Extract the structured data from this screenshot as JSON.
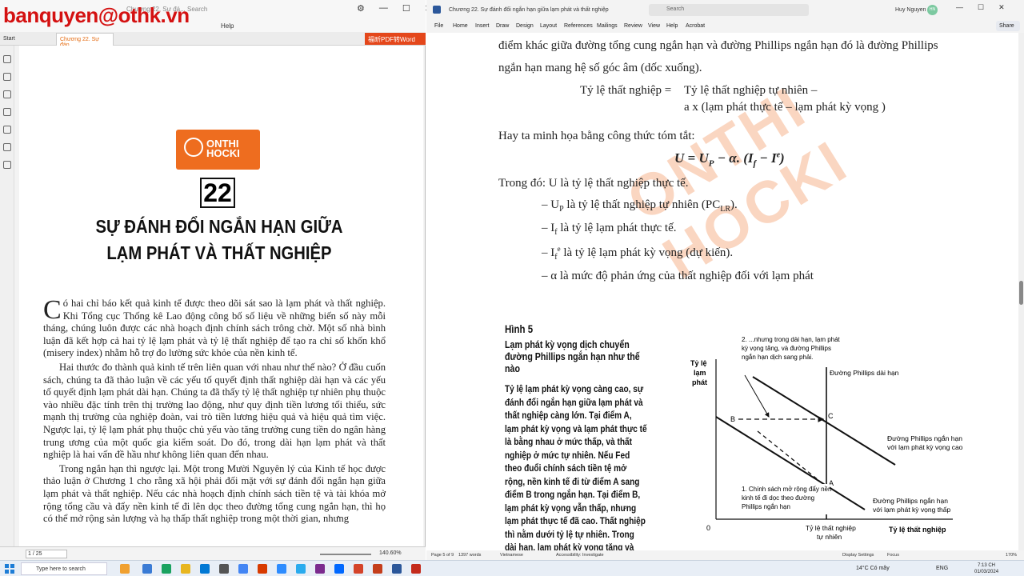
{
  "watermark": "banquyen@othk.vn",
  "left": {
    "search_placeholder": "Chương 22. Sự đá... Search",
    "menu_help": "Help",
    "tab_start": "Start",
    "tab_doc": "Chương 22. Sự đán...",
    "pdf_word_button": "福昕PDF转Word",
    "logo": {
      "line1": "ONTHI",
      "line2": "HOCKI"
    },
    "chapter_number": "22",
    "chapter_title_line1": "SỰ ĐÁNH ĐỔI NGẮN HẠN GIỮA",
    "chapter_title_line2": "LẠM PHÁT VÀ THẤT NGHIỆP",
    "dropcap": "C",
    "para1_rest": "ó hai chỉ báo kết quả kinh tế được theo dõi sát sao là lạm phát và thất nghiệp. Khi Tổng cục Thống kê Lao động công bố số liệu về những biến số này mỗi tháng, chúng luôn được các nhà hoạch định chính sách trông chờ. Một số nhà bình luận đã kết hợp cả hai tỷ lệ lạm phát và tỷ lệ thất nghiệp để tạo ra chỉ số khốn khổ (misery index) nhằm hỗ trợ đo lường sức khỏe của nền kinh tế.",
    "para2": "Hai thước đo thành quả kinh tế trên liên quan với nhau như thế nào? Ở đầu cuốn sách, chúng ta đã thảo luận về các yếu tố quyết định thất nghiệp dài hạn và các yếu tố quyết định lạm phát dài hạn. Chúng ta đã thấy tỷ lệ thất nghiệp tự nhiên phụ thuộc vào nhiều đặc tính trên thị trường lao động, như quy định tiền lương tối thiểu, sức mạnh thị trường của nghiệp đoàn, vai trò tiền lương hiệu quả và hiệu quả tìm việc. Ngược lại, tỷ lệ lạm phát phụ thuộc chủ yếu vào tăng trưởng cung tiền do ngân hàng trung ương của một quốc gia kiểm soát. Do đó, trong dài hạn lạm phát và thất nghiệp là hai vấn đề hầu như không liên quan đến nhau.",
    "para3": "Trong ngắn hạn thì ngược lại. Một trong Mười Nguyên lý của Kinh tế học được thảo luận ở Chương 1 cho rằng xã hội phải đối mặt với sự đánh đổi ngắn hạn giữa lạm phát và thất nghiệp. Nếu các nhà hoạch định chính sách tiền tệ và tài khóa mở rộng tổng cầu và đẩy nền kinh tế đi lên dọc theo đường tổng cung ngắn hạn, thì họ có thể mở rộng sản lượng và hạ thấp thất nghiệp trong một thời gian, nhưng",
    "page_info": "1 / 25",
    "zoom": "140.60%"
  },
  "right": {
    "doc_title": "Chương 22. Sự đánh đổi ngắn hạn giữa lạm phát và thất nghiệp",
    "search_placeholder": "Search",
    "user_name": "Huy Nguyen",
    "user_initials": "HN",
    "ribbon_tabs": [
      "File",
      "Home",
      "Insert",
      "Draw",
      "Design",
      "Layout",
      "References",
      "Mailings",
      "Review",
      "View",
      "Help",
      "Acrobat"
    ],
    "share_label": "Share",
    "line1": "điểm khác giữa đường tổng cung ngắn hạn và đường Phillips ngắn hạn đó là đường Phillips",
    "line2": "ngắn hạn mang hệ số góc âm (dốc xuống).",
    "formula_lhs": "Tỷ lệ thất nghiệp =",
    "formula_rhs1": "Tỷ lệ thất nghiệp tự nhiên –",
    "formula_rhs2": "a x (lạm phát thực tế – lạm phát kỳ vọng )",
    "summary_intro": "Hay ta minh họa bằng công thức tóm tắt:",
    "formula2": "U = U",
    "formula2_sub": "P",
    "formula2_rest": " − α. (I",
    "formula2_f": "f",
    "formula2_mid": " − I",
    "formula2_e": "e",
    "formula2_end": ")",
    "where_line": "Trong đó: U là tỷ lệ thất nghiệp thực tế.",
    "bullet1": "– U",
    "bullet1_sub": "P",
    "bullet1_rest": " là tỷ lệ thất nghiệp tự nhiên (PC",
    "bullet1_sub2": "LR",
    "bullet1_end": ").",
    "bullet2": "– I",
    "bullet2_sub": "f",
    "bullet2_rest": " là tỷ lệ lạm phát thực tế.",
    "bullet3": "– I",
    "bullet3_sub": "f",
    "bullet3_sup": "e",
    "bullet3_rest": " là tỷ lệ lạm phát kỳ vọng (dự kiến).",
    "bullet4": "– α là mức độ phản ứng của thất nghiệp đối với lạm phát",
    "page_watermark": "ONTHI HOCKI",
    "figure": {
      "number": "Hình 5",
      "subtitle": "Lạm phát kỳ vọng dịch chuyển đường Phillips ngắn hạn như thế nào",
      "body": "Tỷ lệ lạm phát kỳ vọng càng cao, sự đánh đổi ngắn hạn giữa lạm phát và thất nghiệp càng lớn. Tại điểm A, lạm phát kỳ vọng và lạm phát thực tế là bằng nhau ở mức thấp, và thất nghiệp ở mức tự nhiên. Nếu Fed theo đuổi chính sách tiền tệ mở rộng, nền kinh tế đi từ điểm A sang điểm B trong ngắn hạn. Tại điểm B, lạm phát kỳ vọng vẫn thấp, nhưng lạm phát thực tế đã cao. Thất nghiệp thì nằm dưới tỷ lệ tự nhiên. Trong dài hạn, lạm phát kỳ vọng tăng và nền kinh tế chuyển sang điểm C. Tại đây, lạm phát kỳ vọng và lạm phát thực tế đều cao, và",
      "y_axis": [
        "Tỷ lệ",
        "lạm",
        "phát"
      ],
      "x_axis": "Tỷ lệ thất nghiệp",
      "natural_rate_1": "Tỷ lệ thất nghiệp",
      "natural_rate_2": "tự nhiên",
      "origin": "0",
      "lr_label": "Đường Phillips dài hạn",
      "sr_high_1": "Đường Phillips ngắn hạn",
      "sr_high_2": "với lạm phát kỳ vọng cao",
      "sr_low_1": "Đường Phillips ngắn hạn",
      "sr_low_2": "với lạm phát kỳ vọng thấp",
      "note2_1": "2. ...nhưng trong dài hạn, lạm phát",
      "note2_2": "kỳ vọng tăng, và đường Phillips",
      "note2_3": "ngắn hạn dịch sang phải.",
      "note1_1": "1. Chính sách mở rộng đẩy nền",
      "note1_2": "kinh tế đi dọc theo đường",
      "note1_3": "Phillips ngắn hạn",
      "point_a": "A",
      "point_b": "B",
      "point_c": "C"
    },
    "status_page": "Page 5 of 9",
    "status_words": "1397 words",
    "status_lang": "Vietnamese",
    "status_access": "Accessibility: Investigate",
    "status_display": "Display Settings",
    "status_focus": "Focus",
    "status_zoom": "170%"
  },
  "taskbar": {
    "search_placeholder": "Type here to search",
    "weather": "14°C  Có mây",
    "lang": "ENG",
    "time": "7:13 CH",
    "date": "01/03/2024"
  },
  "colors": {
    "accent_orange": "#ee6d1f",
    "watermark_red": "#d41111",
    "word_blue": "#2b579a"
  }
}
